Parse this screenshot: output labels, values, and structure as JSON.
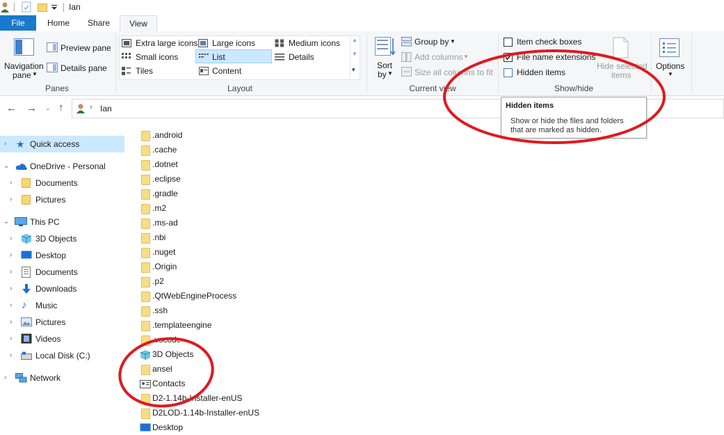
{
  "window": {
    "title": "Ian"
  },
  "tabs": {
    "file": "File",
    "home": "Home",
    "share": "Share",
    "view": "View"
  },
  "ribbon": {
    "panes": {
      "navigation_pane_1": "Navigation",
      "navigation_pane_2": "pane",
      "preview_pane": "Preview pane",
      "details_pane": "Details pane",
      "label": "Panes"
    },
    "layout": {
      "options": [
        "Extra large icons",
        "Large icons",
        "Medium icons",
        "Small icons",
        "List",
        "Details",
        "Tiles",
        "Content"
      ],
      "selected": "List",
      "label": "Layout"
    },
    "current_view": {
      "sort_1": "Sort",
      "sort_2": "by",
      "group_by": "Group by",
      "add_columns": "Add columns",
      "size_columns": "Size all columns to fit",
      "label": "Current view"
    },
    "show_hide": {
      "item_check_boxes": "Item check boxes",
      "item_check_boxes_checked": false,
      "file_name_extensions": "File name extensions",
      "file_name_extensions_checked": true,
      "hidden_items": "Hidden items",
      "hidden_items_checked": false,
      "hide_selected_1": "Hide selected",
      "hide_selected_2": "items",
      "label": "Show/hide"
    },
    "options": {
      "label": "Options"
    }
  },
  "address": {
    "path": "Ian"
  },
  "tooltip": {
    "title": "Hidden items",
    "body_1": "Show or hide the files and folders",
    "body_2": "that are marked as hidden."
  },
  "sidebar": {
    "items": [
      {
        "label": "Quick access",
        "icon": "star-icon"
      },
      {
        "label": "OneDrive - Personal",
        "icon": "cloud-icon"
      },
      {
        "label": "Documents",
        "icon": "folder-icon"
      },
      {
        "label": "Pictures",
        "icon": "folder-icon"
      },
      {
        "label": "This PC",
        "icon": "computer-icon"
      },
      {
        "label": "3D Objects",
        "icon": "cube-icon"
      },
      {
        "label": "Desktop",
        "icon": "desktop-icon"
      },
      {
        "label": "Documents",
        "icon": "document-icon"
      },
      {
        "label": "Downloads",
        "icon": "download-icon"
      },
      {
        "label": "Music",
        "icon": "music-icon"
      },
      {
        "label": "Pictures",
        "icon": "picture-icon"
      },
      {
        "label": "Videos",
        "icon": "video-icon"
      },
      {
        "label": "Local Disk (C:)",
        "icon": "disk-icon"
      },
      {
        "label": "Network",
        "icon": "network-icon"
      }
    ]
  },
  "files": [
    {
      "name": ".android",
      "icon": "folder-icon"
    },
    {
      "name": ".cache",
      "icon": "folder-icon"
    },
    {
      "name": ".dotnet",
      "icon": "folder-icon"
    },
    {
      "name": ".eclipse",
      "icon": "folder-icon"
    },
    {
      "name": ".gradle",
      "icon": "folder-icon"
    },
    {
      "name": ".m2",
      "icon": "folder-icon"
    },
    {
      "name": ".ms-ad",
      "icon": "folder-icon"
    },
    {
      "name": ".nbi",
      "icon": "folder-icon"
    },
    {
      "name": ".nuget",
      "icon": "folder-icon"
    },
    {
      "name": ".Origin",
      "icon": "folder-icon"
    },
    {
      "name": ".p2",
      "icon": "folder-icon"
    },
    {
      "name": ".QtWebEngineProcess",
      "icon": "folder-icon"
    },
    {
      "name": ".ssh",
      "icon": "folder-icon"
    },
    {
      "name": ".templateengine",
      "icon": "folder-icon"
    },
    {
      "name": ".vscode",
      "icon": "folder-icon"
    },
    {
      "name": "3D Objects",
      "icon": "cube-icon"
    },
    {
      "name": "ansel",
      "icon": "folder-icon"
    },
    {
      "name": "Contacts",
      "icon": "contacts-icon"
    },
    {
      "name": "D2-1.14b-Installer-enUS",
      "icon": "folder-icon"
    },
    {
      "name": "D2LOD-1.14b-Installer-enUS",
      "icon": "folder-icon"
    },
    {
      "name": "Desktop",
      "icon": "desktop-icon"
    }
  ],
  "colors": {
    "accent": "#1979ca",
    "annotation": "#e0191f",
    "folder": "#f8dd85",
    "ribbon_bg": "#f5f6f7",
    "selection": "#cce8ff"
  }
}
